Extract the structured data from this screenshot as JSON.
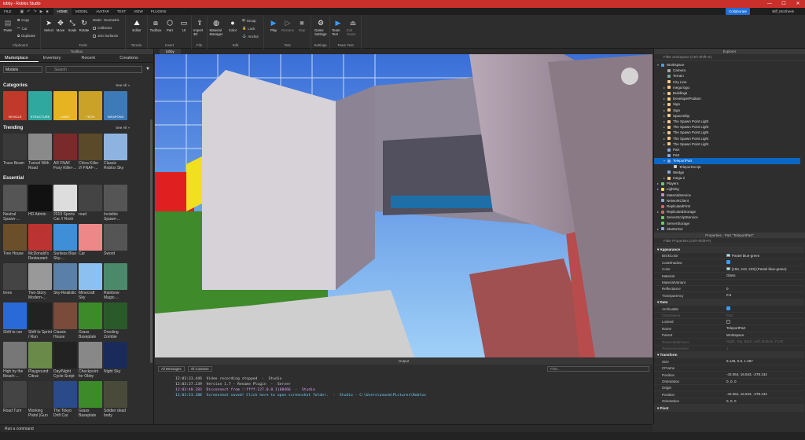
{
  "window": {
    "title": "lobby - Roblox Studio",
    "controls": [
      "—",
      "☐",
      "✕"
    ]
  },
  "menu": {
    "file": "FILE",
    "tabs": [
      "HOME",
      "MODEL",
      "AVATAR",
      "TEST",
      "VIEW",
      "PLUGINS"
    ],
    "active_tab": "HOME",
    "collaborate": "Collaborate",
    "user": "Biff_McSheek"
  },
  "ribbon": {
    "clipboard": {
      "label": "Clipboard",
      "paste": "Paste",
      "copy": "Copy",
      "cut": "Cut",
      "duplicate": "Duplicate"
    },
    "tools": {
      "label": "Tools",
      "select": "Select",
      "move": "Move",
      "scale": "Scale",
      "rotate": "Rotate",
      "mode_label": "Mode:",
      "mode_value": "Geometric",
      "collisions": "Collisions",
      "join_surfaces": "Join Surfaces"
    },
    "terrain": {
      "label": "Terrain",
      "editor": "Editor"
    },
    "insert": {
      "label": "Insert",
      "toolbox": "Toolbox",
      "part": "Part",
      "ui": "UI"
    },
    "file": {
      "label": "File",
      "import3d": "Import 3D"
    },
    "edit": {
      "label": "Edit",
      "material_manager": "Material Manager",
      "color": "Color",
      "group": "Group",
      "lock": "Lock",
      "anchor": "Anchor"
    },
    "test": {
      "label": "Test",
      "play": "Play",
      "resume": "Resume",
      "stop": "Stop"
    },
    "settings": {
      "label": "Settings",
      "game_settings": "Game Settings"
    },
    "team_test": {
      "label": "Team Test",
      "team_test": "Team Test",
      "exit_game": "Exit Game"
    }
  },
  "toolbox": {
    "title": "Toolbox",
    "tabs": [
      "Marketplace",
      "Inventory",
      "Recent",
      "Creations"
    ],
    "category_select": "Models",
    "search_placeholder": "Search",
    "categories_title": "Categories",
    "see_all": "See All »",
    "categories": [
      {
        "label": "VEHICLE",
        "color": "#c0392b"
      },
      {
        "label": "STRUCTURE",
        "color": "#2fa9a0"
      },
      {
        "label": "LIGHT",
        "color": "#e6b422"
      },
      {
        "label": "TECH",
        "color": "#c9a227"
      },
      {
        "label": "WEAPONS",
        "color": "#3d7ab8"
      }
    ],
    "trending_title": "Trending",
    "trending": [
      {
        "name": "Truss Beam",
        "color": "#3a3a3a"
      },
      {
        "name": "Tunnel With Road",
        "color": "#8a8a8a"
      },
      {
        "name": "AR FNAF Foxy Killer-...",
        "color": "#7a2a2a"
      },
      {
        "name": "Chica Killer /// FNAF-...",
        "color": "#5a4a2a"
      },
      {
        "name": "Classic Roblox Sky",
        "color": "#8fb3e0"
      }
    ],
    "essential_title": "Essential",
    "essential": [
      [
        {
          "name": "Neutral Spawn-...",
          "color": "#555"
        },
        {
          "name": "HD Admin",
          "color": "#111"
        },
        {
          "name": "2019 Sports Car // Rosh",
          "color": "#ddd"
        },
        {
          "name": "road",
          "color": "#444"
        },
        {
          "name": "Invisible Spawn-...",
          "color": "#555"
        }
      ],
      [
        {
          "name": "Tree House",
          "color": "#6b4f2a"
        },
        {
          "name": "McDonald's Restaurant",
          "color": "#b33"
        },
        {
          "name": "Sunless Blue Sky-...",
          "color": "#3f8fd8"
        },
        {
          "name": "Car",
          "color": "#e88"
        },
        {
          "name": "Sword",
          "color": "#555"
        }
      ],
      [
        {
          "name": "trees",
          "color": "#444"
        },
        {
          "name": "Two-Story Modern-...",
          "color": "#999"
        },
        {
          "name": "Sky-Realistic",
          "color": "#5a7fa8"
        },
        {
          "name": "Minecraft Sky",
          "color": "#8cc0f0"
        },
        {
          "name": "Rainbow Magic-...",
          "color": "#4a8a6a"
        }
      ],
      [
        {
          "name": "Shift to run",
          "color": "#2a6ad8"
        },
        {
          "name": "Shift to Sprint / Run",
          "color": "#222"
        },
        {
          "name": "Classic House",
          "color": "#7a4a3a"
        },
        {
          "name": "Grass Baseplate",
          "color": "#3d8a2a"
        },
        {
          "name": "Drooling Zombie",
          "color": "#2a5a2a"
        }
      ],
      [
        {
          "name": "High by the Beach-...",
          "color": "#777"
        },
        {
          "name": "Playground: Citrus",
          "color": "#6a8a4a"
        },
        {
          "name": "Day/Night Cycle Script",
          "color": "#222"
        },
        {
          "name": "Checkpoint for Obby",
          "color": "#888"
        },
        {
          "name": "Night Sky",
          "color": "#1a2a5a"
        }
      ],
      [
        {
          "name": "Road Turn",
          "color": "#444"
        },
        {
          "name": "Working Pistol (Gun",
          "color": "#333"
        },
        {
          "name": "The Tokyo Drift Car",
          "color": "#2a4a8a"
        },
        {
          "name": "Grass Baseplate",
          "color": "#3d8a2a"
        },
        {
          "name": "Soldier dead body",
          "color": "#4a4a3a"
        }
      ]
    ]
  },
  "viewport": {
    "tab": "lobby"
  },
  "output": {
    "title": "Output",
    "filter1": "All Messages",
    "filter2": "All Contexts",
    "filter_placeholder": "Filter...",
    "lines": [
      {
        "text": "12:03:33.446  Video recording stopped  -  Studio",
        "color": "#cccccc"
      },
      {
        "text": "12:03:37.239  Version 1.7 - Rename Plugin  -  Server",
        "color": "#cccccc"
      },
      {
        "text": "12:03:40.283  Disconnect from ::ffff:127.0.0.1|60466  -  Studio",
        "color": "#e0a0ff"
      },
      {
        "text": "12:03:53.288  Screenshot saved! Click here to open screenshot folder.  -  Studio - C:\\Users\\anonm\\Pictures\\Roblox",
        "color": "#6fd0ff"
      }
    ]
  },
  "command_bar": {
    "placeholder": "Run a command"
  },
  "explorer": {
    "title": "Explorer",
    "filter": "Filter workspace (Ctrl+Shift+X)",
    "items": [
      {
        "label": "Workspace",
        "depth": 0,
        "arrow": "▾",
        "color": "#4aa0e0"
      },
      {
        "label": "Camera",
        "depth": 1,
        "arrow": "",
        "color": "#aaa"
      },
      {
        "label": "Terrain",
        "depth": 1,
        "arrow": "",
        "color": "#7a9"
      },
      {
        "label": "City Line",
        "depth": 1,
        "arrow": "",
        "color": "#fc8"
      },
      {
        "label": "mega logo",
        "depth": 1,
        "arrow": "▸",
        "color": "#fc8"
      },
      {
        "label": "Buildings",
        "depth": 1,
        "arrow": "▸",
        "color": "#fc8"
      },
      {
        "label": "DeveloperPodium",
        "depth": 1,
        "arrow": "▸",
        "color": "#fc8"
      },
      {
        "label": "Sign",
        "depth": 1,
        "arrow": "▸",
        "color": "#fc8"
      },
      {
        "label": "Sign",
        "depth": 1,
        "arrow": "▸",
        "color": "#fc8"
      },
      {
        "label": "Spaceship",
        "depth": 1,
        "arrow": "▸",
        "color": "#fc8"
      },
      {
        "label": "The Spawn Point Light",
        "depth": 1,
        "arrow": "▸",
        "color": "#fc8"
      },
      {
        "label": "The Spawn Point Light",
        "depth": 1,
        "arrow": "▸",
        "color": "#fc8"
      },
      {
        "label": "The Spawn Point Light",
        "depth": 1,
        "arrow": "▸",
        "color": "#fc8"
      },
      {
        "label": "The Spawn Point Light",
        "depth": 1,
        "arrow": "▸",
        "color": "#fc8"
      },
      {
        "label": "The Spawn Point Light",
        "depth": 1,
        "arrow": "▸",
        "color": "#fc8"
      },
      {
        "label": "Part",
        "depth": 1,
        "arrow": "",
        "color": "#8ad"
      },
      {
        "label": "Part",
        "depth": 1,
        "arrow": "",
        "color": "#8ad"
      },
      {
        "label": "TeleportPart",
        "depth": 1,
        "arrow": "▾",
        "color": "#8ad",
        "selected": true
      },
      {
        "label": "TeleportScript",
        "depth": 2,
        "arrow": "",
        "color": "#ccc"
      },
      {
        "label": "Wedge",
        "depth": 1,
        "arrow": "",
        "color": "#8ad"
      },
      {
        "label": "mega 2",
        "depth": 1,
        "arrow": "▸",
        "color": "#fc8"
      },
      {
        "label": "Players",
        "depth": 0,
        "arrow": "▸",
        "color": "#6c6"
      },
      {
        "label": "Lighting",
        "depth": 0,
        "arrow": "▸",
        "color": "#fd4"
      },
      {
        "label": "MaterialService",
        "depth": 0,
        "arrow": "",
        "color": "#c8c"
      },
      {
        "label": "NetworkClient",
        "depth": 0,
        "arrow": "",
        "color": "#8ad"
      },
      {
        "label": "ReplicatedFirst",
        "depth": 0,
        "arrow": "",
        "color": "#c66"
      },
      {
        "label": "ReplicatedStorage",
        "depth": 0,
        "arrow": "▸",
        "color": "#c66"
      },
      {
        "label": "ServerScriptService",
        "depth": 0,
        "arrow": "",
        "color": "#6c6"
      },
      {
        "label": "ServerStorage",
        "depth": 0,
        "arrow": "",
        "color": "#6c6"
      },
      {
        "label": "StarterGui",
        "depth": 0,
        "arrow": "▸",
        "color": "#8ad"
      }
    ]
  },
  "properties": {
    "title": "Properties - Part \"TeleportPart\"",
    "filter": "Filter Properties (Ctrl+Shift+P)",
    "rows": [
      {
        "name": "Appearance",
        "value": "",
        "type": "head"
      },
      {
        "name": "BrickColor",
        "value": "Pastel blue-green",
        "type": "swatch"
      },
      {
        "name": "CastShadow",
        "value": "",
        "type": "check_on"
      },
      {
        "name": "Color",
        "value": "[159, 243, 233] (Pastel blue-green)",
        "type": "swatch"
      },
      {
        "name": "Material",
        "value": "Glass",
        "type": "text"
      },
      {
        "name": "MaterialVariant",
        "value": "",
        "type": "text"
      },
      {
        "name": "Reflectance",
        "value": "0",
        "type": "text"
      },
      {
        "name": "Transparency",
        "value": "0.6",
        "type": "text"
      },
      {
        "name": "Data",
        "value": "",
        "type": "head"
      },
      {
        "name": "Archivable",
        "value": "",
        "type": "check_on"
      },
      {
        "name": "ClassName",
        "value": "Part",
        "type": "dim"
      },
      {
        "name": "Locked",
        "value": "",
        "type": "check_off"
      },
      {
        "name": "Name",
        "value": "TeleportPart",
        "type": "text"
      },
      {
        "name": "Parent",
        "value": "Workspace",
        "type": "text"
      },
      {
        "name": "ResizeableFaces",
        "value": "Right, Top, Back, Left, Bottom, Front",
        "type": "dim"
      },
      {
        "name": "ResizeIncrement",
        "value": "1",
        "type": "dim"
      },
      {
        "name": "Transform",
        "value": "",
        "type": "head"
      },
      {
        "name": "Size",
        "value": "9.148, 5.9, 1.287",
        "type": "text"
      },
      {
        "name": "CFrame",
        "value": "",
        "type": "text"
      },
      {
        "name": "Position",
        "value": "-42.064, 16.943, -278.134",
        "type": "text"
      },
      {
        "name": "Orientation",
        "value": "0, 0, 0",
        "type": "text"
      },
      {
        "name": "Origin",
        "value": "",
        "type": "text"
      },
      {
        "name": "Position",
        "value": "-42.064, 16.943, -278.134",
        "type": "text"
      },
      {
        "name": "Orientation",
        "value": "0, 0, 0",
        "type": "text"
      },
      {
        "name": "Pivot",
        "value": "",
        "type": "head"
      }
    ]
  }
}
